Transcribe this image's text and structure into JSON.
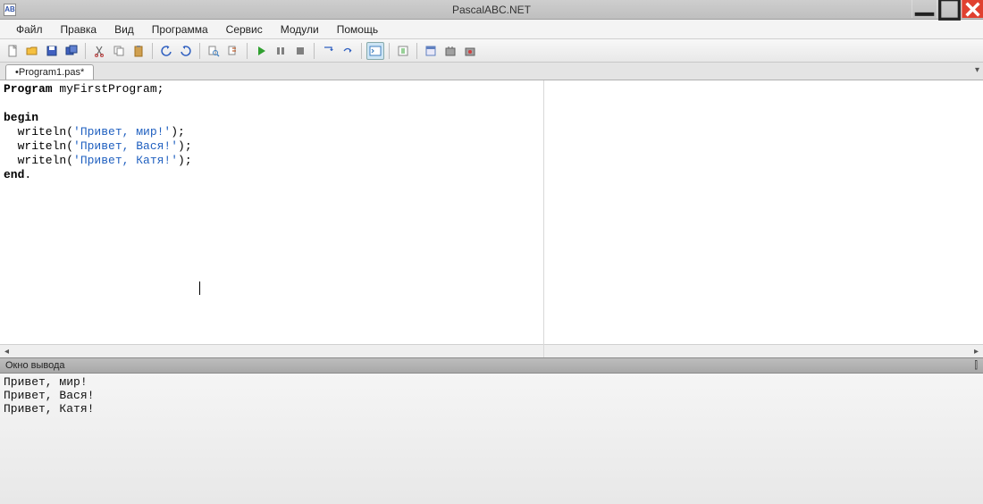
{
  "window": {
    "title": "PascalABC.NET",
    "app_icon_text": "AB"
  },
  "menu": {
    "items": [
      "Файл",
      "Правка",
      "Вид",
      "Программа",
      "Сервис",
      "Модули",
      "Помощь"
    ]
  },
  "toolbar": {
    "buttons": [
      {
        "name": "new-file-icon"
      },
      {
        "name": "open-file-icon"
      },
      {
        "name": "save-icon"
      },
      {
        "name": "save-all-icon"
      },
      {
        "sep": true
      },
      {
        "name": "cut-icon"
      },
      {
        "name": "copy-icon"
      },
      {
        "name": "paste-icon"
      },
      {
        "sep": true
      },
      {
        "name": "undo-icon"
      },
      {
        "name": "redo-icon"
      },
      {
        "sep": true
      },
      {
        "name": "find-icon"
      },
      {
        "name": "replace-icon"
      },
      {
        "sep": true
      },
      {
        "name": "run-icon"
      },
      {
        "name": "pause-icon"
      },
      {
        "name": "stop-icon"
      },
      {
        "sep": true
      },
      {
        "name": "step-into-icon"
      },
      {
        "name": "step-over-icon"
      },
      {
        "sep": true
      },
      {
        "name": "console-icon",
        "active": true
      },
      {
        "sep": true
      },
      {
        "name": "compile-icon"
      },
      {
        "sep": true
      },
      {
        "name": "form-designer-icon"
      },
      {
        "name": "generate-exe-icon"
      },
      {
        "name": "build-icon"
      }
    ]
  },
  "tabs": {
    "active": "•Program1.pas*"
  },
  "editor": {
    "program_decl_kw": "Program",
    "program_name": " myFirstProgram;",
    "begin_kw": "begin",
    "line1_pre": "  writeln(",
    "line1_str": "'Привет, мир!'",
    "line1_post": ");",
    "line2_pre": "  writeln(",
    "line2_str": "'Привет, Вася!'",
    "line2_post": ");",
    "line3_pre": "  writeln(",
    "line3_str": "'Привет, Катя!'",
    "line3_post": ");",
    "end_kw": "end",
    "end_dot": "."
  },
  "output": {
    "title": "Окно вывода",
    "lines": [
      "Привет, мир!",
      "Привет, Вася!",
      "Привет, Катя!"
    ]
  }
}
